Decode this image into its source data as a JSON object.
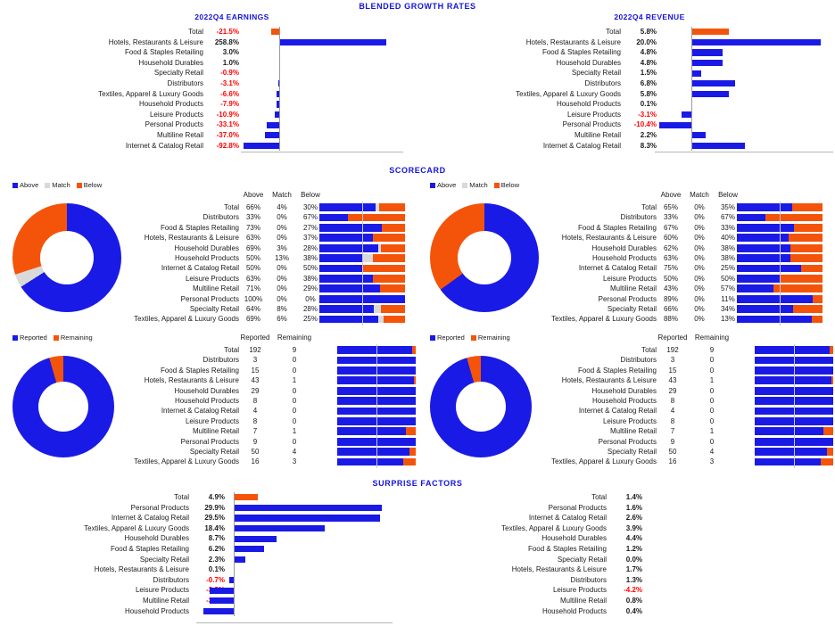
{
  "colors": {
    "blue": "#1a1ae6",
    "orange": "#f4540a",
    "gray": "#d9d9d9",
    "title_blue": "#1414dc",
    "negative_red": "#ff0000",
    "axis": "#9a9a9a"
  },
  "sections": {
    "growth": {
      "title": "BLENDED GROWTH RATES"
    },
    "scorecard": {
      "title": "SCORECARD"
    },
    "surprise": {
      "title": "SURPRISE FACTORS"
    }
  },
  "growth_earnings": {
    "title": "2022Q4 EARNINGS",
    "chart_data": {
      "type": "bar",
      "title": "2022Q4 EARNINGS",
      "orientation": "horizontal",
      "xlabel": "",
      "ylabel": "",
      "categories": [
        "Total",
        "Hotels, Restaurants & Leisure",
        "Food & Staples Retailing",
        "Household Durables",
        "Specialty Retail",
        "Distributors",
        "Textiles, Apparel & Luxury Goods",
        "Household Products",
        "Leisure Products",
        "Personal Products",
        "Multiline Retail",
        "Internet & Catalog Retail"
      ],
      "values": [
        -21.5,
        258.8,
        3.0,
        1.0,
        -0.9,
        -3.1,
        -6.6,
        -7.9,
        -10.9,
        -33.1,
        -37.0,
        -92.8
      ],
      "labels": [
        "-21.5%",
        "258.8%",
        "3.0%",
        "1.0%",
        "-0.9%",
        "-3.1%",
        "-6.6%",
        "-7.9%",
        "-10.9%",
        "-33.1%",
        "-37.0%",
        "-92.8%"
      ],
      "highlight_first": true,
      "xlim": [
        -100,
        300
      ]
    }
  },
  "growth_revenue": {
    "title": "2022Q4 REVENUE",
    "chart_data": {
      "type": "bar",
      "title": "2022Q4 REVENUE",
      "orientation": "horizontal",
      "xlabel": "",
      "ylabel": "",
      "categories": [
        "Total",
        "Hotels, Restaurants & Leisure",
        "Food & Staples Retailing",
        "Household Durables",
        "Specialty Retail",
        "Distributors",
        "Textiles, Apparel & Luxury Goods",
        "Household Products",
        "Leisure Products",
        "Personal Products",
        "Multiline Retail",
        "Internet & Catalog Retail"
      ],
      "values": [
        5.8,
        20.0,
        4.8,
        4.8,
        1.5,
        6.8,
        5.8,
        0.1,
        -3.1,
        -10.4,
        2.2,
        8.3
      ],
      "labels": [
        "5.8%",
        "20.0%",
        "4.8%",
        "4.8%",
        "1.5%",
        "6.8%",
        "5.8%",
        "0.1%",
        "-3.1%",
        "-10.4%",
        "2.2%",
        "8.3%"
      ],
      "highlight_first": true,
      "xlim": [
        -12,
        22
      ]
    }
  },
  "scorecard_earnings": {
    "legend": [
      {
        "label": "Above",
        "color": "#1a1ae6"
      },
      {
        "label": "Match",
        "color": "#d9d9d9"
      },
      {
        "label": "Below",
        "color": "#f4540a"
      }
    ],
    "headers": [
      "Above",
      "Match",
      "Below"
    ],
    "chart_data": {
      "type": "bar",
      "stacked": true,
      "title": "SCORECARD - 2022Q4 EARNINGS",
      "series": [
        {
          "name": "Above",
          "values": [
            66,
            33,
            73,
            63,
            69,
            50,
            50,
            63,
            71,
            100,
            64,
            69
          ]
        },
        {
          "name": "Match",
          "values": [
            4,
            0,
            0,
            0,
            3,
            13,
            0,
            0,
            0,
            0,
            8,
            6
          ]
        },
        {
          "name": "Below",
          "values": [
            30,
            67,
            27,
            37,
            28,
            38,
            50,
            38,
            29,
            0,
            28,
            25
          ]
        }
      ],
      "categories": [
        "Total",
        "Distributors",
        "Food & Staples Retailing",
        "Hotels, Restaurants & Leisure",
        "Household Durables",
        "Household Products",
        "Internet & Catalog Retail",
        "Leisure Products",
        "Multiline Retail",
        "Personal Products",
        "Specialty Retail",
        "Textiles, Apparel & Luxury Goods"
      ],
      "labels": [
        [
          "66%",
          "4%",
          "30%"
        ],
        [
          "33%",
          "0%",
          "67%"
        ],
        [
          "73%",
          "0%",
          "27%"
        ],
        [
          "63%",
          "0%",
          "37%"
        ],
        [
          "69%",
          "3%",
          "28%"
        ],
        [
          "50%",
          "13%",
          "38%"
        ],
        [
          "50%",
          "0%",
          "50%"
        ],
        [
          "63%",
          "0%",
          "38%"
        ],
        [
          "71%",
          "0%",
          "29%"
        ],
        [
          "100%",
          "0%",
          "0%"
        ],
        [
          "64%",
          "8%",
          "28%"
        ],
        [
          "69%",
          "6%",
          "25%"
        ]
      ],
      "donut": {
        "values": [
          66,
          4,
          30
        ],
        "labels": [
          "Above",
          "Match",
          "Below"
        ]
      }
    }
  },
  "scorecard_revenue": {
    "legend": [
      {
        "label": "Above",
        "color": "#1a1ae6"
      },
      {
        "label": "Match",
        "color": "#d9d9d9"
      },
      {
        "label": "Below",
        "color": "#f4540a"
      }
    ],
    "headers": [
      "Above",
      "Match",
      "Below"
    ],
    "chart_data": {
      "type": "bar",
      "stacked": true,
      "title": "SCORECARD - 2022Q4 REVENUE",
      "series": [
        {
          "name": "Above",
          "values": [
            65,
            33,
            67,
            60,
            62,
            63,
            75,
            50,
            43,
            89,
            66,
            88
          ]
        },
        {
          "name": "Match",
          "values": [
            0,
            0,
            0,
            0,
            0,
            0,
            0,
            0,
            0,
            0,
            0,
            0
          ]
        },
        {
          "name": "Below",
          "values": [
            35,
            67,
            33,
            40,
            38,
            38,
            25,
            50,
            57,
            11,
            34,
            13
          ]
        }
      ],
      "categories": [
        "Total",
        "Distributors",
        "Food & Staples Retailing",
        "Hotels, Restaurants & Leisure",
        "Household Durables",
        "Household Products",
        "Internet & Catalog Retail",
        "Leisure Products",
        "Multiline Retail",
        "Personal Products",
        "Specialty Retail",
        "Textiles, Apparel & Luxury Goods"
      ],
      "labels": [
        [
          "65%",
          "0%",
          "35%"
        ],
        [
          "33%",
          "0%",
          "67%"
        ],
        [
          "67%",
          "0%",
          "33%"
        ],
        [
          "60%",
          "0%",
          "40%"
        ],
        [
          "62%",
          "0%",
          "38%"
        ],
        [
          "63%",
          "0%",
          "38%"
        ],
        [
          "75%",
          "0%",
          "25%"
        ],
        [
          "50%",
          "0%",
          "50%"
        ],
        [
          "43%",
          "0%",
          "57%"
        ],
        [
          "89%",
          "0%",
          "11%"
        ],
        [
          "66%",
          "0%",
          "34%"
        ],
        [
          "88%",
          "0%",
          "13%"
        ]
      ],
      "donut": {
        "values": [
          65,
          0,
          35
        ],
        "labels": [
          "Above",
          "Match",
          "Below"
        ]
      }
    }
  },
  "counts_earnings": {
    "legend": [
      {
        "label": "Reported",
        "color": "#1a1ae6"
      },
      {
        "label": "Remaining",
        "color": "#f4540a"
      }
    ],
    "headers": [
      "Reported",
      "Remaining"
    ],
    "chart_data": {
      "type": "bar",
      "stacked": true,
      "title": "REPORTED vs REMAINING - EARNINGS",
      "series": [
        {
          "name": "Reported",
          "values": [
            192,
            3,
            15,
            43,
            29,
            8,
            4,
            8,
            7,
            9,
            50,
            16
          ]
        },
        {
          "name": "Remaining",
          "values": [
            9,
            0,
            0,
            1,
            0,
            0,
            0,
            0,
            1,
            0,
            4,
            3
          ]
        }
      ],
      "categories": [
        "Total",
        "Distributors",
        "Food & Staples Retailing",
        "Hotels, Restaurants & Leisure",
        "Household Durables",
        "Household Products",
        "Internet & Catalog Retail",
        "Leisure Products",
        "Multiline Retail",
        "Personal Products",
        "Specialty Retail",
        "Textiles, Apparel & Luxury Goods"
      ],
      "donut": {
        "values": [
          192,
          9
        ],
        "labels": [
          "Reported",
          "Remaining"
        ]
      }
    }
  },
  "counts_revenue": {
    "legend": [
      {
        "label": "Reported",
        "color": "#1a1ae6"
      },
      {
        "label": "Remaining",
        "color": "#f4540a"
      }
    ],
    "headers": [
      "Reported",
      "Remaining"
    ],
    "chart_data": {
      "type": "bar",
      "stacked": true,
      "title": "REPORTED vs REMAINING - REVENUE",
      "series": [
        {
          "name": "Reported",
          "values": [
            192,
            3,
            15,
            43,
            29,
            8,
            4,
            8,
            7,
            9,
            50,
            16
          ]
        },
        {
          "name": "Remaining",
          "values": [
            9,
            0,
            0,
            1,
            0,
            0,
            0,
            0,
            1,
            0,
            4,
            3
          ]
        }
      ],
      "categories": [
        "Total",
        "Distributors",
        "Food & Staples Retailing",
        "Hotels, Restaurants & Leisure",
        "Household Durables",
        "Household Products",
        "Internet & Catalog Retail",
        "Leisure Products",
        "Multiline Retail",
        "Personal Products",
        "Specialty Retail",
        "Textiles, Apparel & Luxury Goods"
      ],
      "donut": {
        "values": [
          192,
          9
        ],
        "labels": [
          "Reported",
          "Remaining"
        ]
      }
    }
  },
  "surprise_earnings": {
    "chart_data": {
      "type": "bar",
      "orientation": "horizontal",
      "title": "SURPRISE FACTORS - EARNINGS",
      "categories": [
        "Total",
        "Personal Products",
        "Internet & Catalog Retail",
        "Textiles, Apparel & Luxury Goods",
        "Household Durables",
        "Food & Staples Retailing",
        "Specialty Retail",
        "Hotels, Restaurants & Leisure",
        "Distributors",
        "Leisure Products",
        "Multiline Retail",
        "Household Products"
      ],
      "values": [
        4.9,
        29.9,
        29.5,
        18.4,
        8.7,
        6.2,
        2.3,
        0.1,
        -0.7,
        -3.9,
        -3.9,
        -4.9
      ],
      "labels": [
        "4.9%",
        "29.9%",
        "29.5%",
        "18.4%",
        "8.7%",
        "6.2%",
        "2.3%",
        "0.1%",
        "-0.7%",
        "-3.9%",
        "-3.9%",
        "-4.9%"
      ],
      "highlight_first": true,
      "xlim": [
        -6,
        32
      ]
    }
  },
  "surprise_revenue": {
    "chart_data": {
      "type": "bar",
      "orientation": "horizontal",
      "title": "SURPRISE FACTORS - REVENUE",
      "categories": [
        "Total",
        "Personal Products",
        "Internet & Catalog Retail",
        "Textiles, Apparel & Luxury Goods",
        "Household Durables",
        "Food & Staples Retailing",
        "Specialty Retail",
        "Hotels, Restaurants & Leisure",
        "Distributors",
        "Leisure Products",
        "Multiline Retail",
        "Household Products"
      ],
      "values": [
        1.4,
        1.6,
        2.6,
        3.9,
        4.4,
        1.2,
        0.0,
        1.7,
        1.3,
        -4.2,
        0.8,
        0.4
      ],
      "labels": [
        "1.4%",
        "1.6%",
        "2.6%",
        "3.9%",
        "4.4%",
        "1.2%",
        "0.0%",
        "1.7%",
        "1.3%",
        "-4.2%",
        "0.8%",
        "0.4%"
      ],
      "highlight_first": true,
      "xlim": [
        -4.6,
        4.8
      ]
    }
  }
}
